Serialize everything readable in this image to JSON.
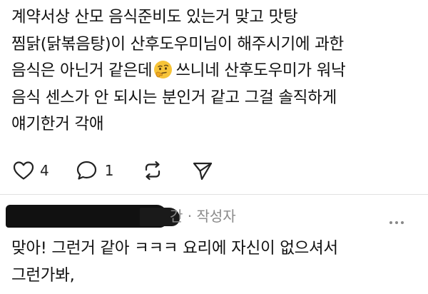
{
  "post": {
    "lines": [
      "계약서상 산모 음식준비도 있는거 맞고 맛탕",
      "찜닭(닭볶음탕)이 산후도우미님이 해주시기에 과한",
      "음식은 아닌거 같은데",
      "쓰니네 산후도우미가 워낙",
      "음식 센스가 안 되시는 분인거 같고 그걸 솔직하게",
      "얘기한거 각애"
    ],
    "emoji": "thinking-face",
    "like_count": "4",
    "reply_count": "1"
  },
  "reply": {
    "meta_fragment": "간",
    "separator": "·",
    "author_badge": "작성자",
    "lines": [
      "맞아! 그런거 같아 ㅋㅋㅋ 요리에 자신이 없으셔서",
      "그런가봐,"
    ]
  },
  "icons": {
    "like": "heart-outline-icon",
    "reply": "comment-bubble-icon",
    "repost": "repost-arrows-icon",
    "share": "send-paper-plane-icon",
    "more": "more-dots-icon"
  }
}
